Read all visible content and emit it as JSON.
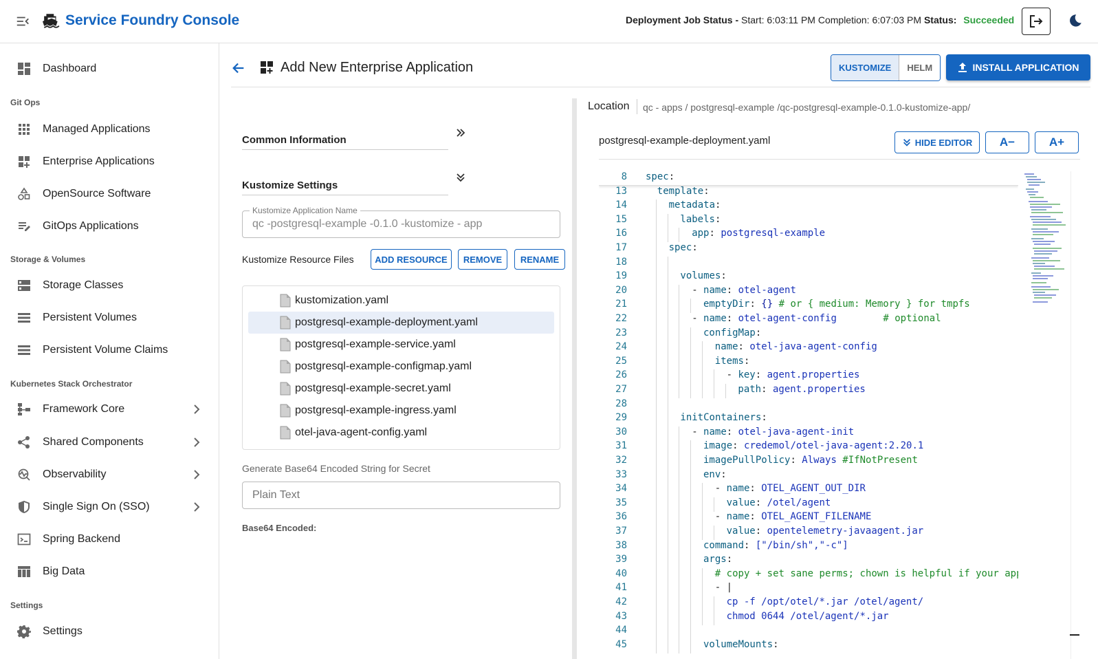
{
  "app": {
    "title": "Service Foundry Console"
  },
  "job_status": {
    "label": "Deployment Job Status -",
    "start_label": "Start:",
    "start": "6:03:11 PM",
    "completion_label": "Completion:",
    "completion": "6:07:03 PM",
    "status_label": "Status:",
    "status": "Succeeded",
    "status_color": "#2e9e3f"
  },
  "sidebar": {
    "items": [
      {
        "label": "Dashboard",
        "icon": "dashboard-icon"
      },
      {
        "section": "Git Ops"
      },
      {
        "label": "Managed Applications",
        "icon": "apps-grid-icon"
      },
      {
        "label": "Enterprise Applications",
        "icon": "widgets-add-icon"
      },
      {
        "label": "OpenSource Software",
        "icon": "shapes-icon"
      },
      {
        "label": "GitOps Applications",
        "icon": "edit-note-icon"
      },
      {
        "section": "Storage & Volumes"
      },
      {
        "label": "Storage Classes",
        "icon": "storage-icon"
      },
      {
        "label": "Persistent Volumes",
        "icon": "list-stack-icon"
      },
      {
        "label": "Persistent Volume Claims",
        "icon": "list-stack-icon"
      },
      {
        "section": "Kubernetes Stack Orchestrator"
      },
      {
        "label": "Framework Core",
        "icon": "schema-icon"
      },
      {
        "label": "Shared Components",
        "icon": "share-icon"
      },
      {
        "label": "Observability",
        "icon": "monitoring-icon"
      },
      {
        "label": "Single Sign On (SSO)",
        "icon": "shield-icon"
      },
      {
        "label": "Spring Backend",
        "icon": "terminal-icon"
      },
      {
        "label": "Big Data",
        "icon": "table-icon"
      },
      {
        "section": "Settings"
      },
      {
        "label": "Settings",
        "icon": "gear-icon"
      }
    ]
  },
  "page": {
    "title": "Add New Enterprise Application",
    "toggle": {
      "kustomize": "KUSTOMIZE",
      "helm": "HELM"
    },
    "install_label": "INSTALL APPLICATION"
  },
  "form": {
    "common_info": "Common Information",
    "kustomize_settings": "Kustomize Settings",
    "app_name_label": "Kustomize Application Name",
    "app_name_value": "qc -postgresql-example -0.1.0 -kustomize - app",
    "resource_files_label": "Kustomize Resource Files",
    "add_resource": "ADD RESOURCE",
    "remove": "REMOVE",
    "rename": "RENAME",
    "files": [
      "kustomization.yaml",
      "postgresql-example-deployment.yaml",
      "postgresql-example-service.yaml",
      "postgresql-example-configmap.yaml",
      "postgresql-example-secret.yaml",
      "postgresql-example-ingress.yaml",
      "otel-java-agent-config.yaml"
    ],
    "selected_file_index": 1,
    "base64_label": "Generate Base64 Encoded String for Secret",
    "base64_placeholder": "Plain Text",
    "base64_encoded_label": "Base64 Encoded:"
  },
  "editor": {
    "location_label": "Location",
    "location_path": "qc - apps / postgresql-example /qc-postgresql-example-0.1.0-kustomize-app/",
    "file_name": "postgresql-example-deployment.yaml",
    "hide_editor": "HIDE EDITOR",
    "font_smaller": "A−",
    "font_larger": "A+",
    "sticky_line": {
      "n": "8",
      "indent": 0,
      "parts": [
        [
          "k",
          "spec"
        ],
        [
          "p",
          ":"
        ]
      ]
    },
    "lines": [
      {
        "n": "13",
        "indent": 1,
        "parts": [
          [
            "k",
            "template"
          ],
          [
            "p",
            ":"
          ]
        ]
      },
      {
        "n": "14",
        "indent": 2,
        "parts": [
          [
            "k",
            "metadata"
          ],
          [
            "p",
            ":"
          ]
        ]
      },
      {
        "n": "15",
        "indent": 3,
        "parts": [
          [
            "k",
            "labels"
          ],
          [
            "p",
            ":"
          ]
        ]
      },
      {
        "n": "16",
        "indent": 4,
        "parts": [
          [
            "k",
            "app"
          ],
          [
            "p",
            ": "
          ],
          [
            "v",
            "postgresql-example"
          ]
        ]
      },
      {
        "n": "17",
        "indent": 2,
        "parts": [
          [
            "k",
            "spec"
          ],
          [
            "p",
            ":"
          ]
        ]
      },
      {
        "n": "18",
        "indent": 3,
        "parts": []
      },
      {
        "n": "19",
        "indent": 3,
        "parts": [
          [
            "k",
            "volumes"
          ],
          [
            "p",
            ":"
          ]
        ]
      },
      {
        "n": "20",
        "indent": 4,
        "parts": [
          [
            "p",
            "- "
          ],
          [
            "k",
            "name"
          ],
          [
            "p",
            ": "
          ],
          [
            "v",
            "otel-agent"
          ]
        ]
      },
      {
        "n": "21",
        "indent": 5,
        "parts": [
          [
            "k",
            "emptyDir"
          ],
          [
            "p",
            ": "
          ],
          [
            "d",
            "{}"
          ],
          [
            "c",
            " # or { medium: Memory } for tmpfs"
          ]
        ]
      },
      {
        "n": "22",
        "indent": 4,
        "parts": [
          [
            "p",
            "- "
          ],
          [
            "k",
            "name"
          ],
          [
            "p",
            ": "
          ],
          [
            "v",
            "otel-agent-config"
          ],
          [
            "c",
            "        # optional"
          ]
        ]
      },
      {
        "n": "23",
        "indent": 5,
        "parts": [
          [
            "k",
            "configMap"
          ],
          [
            "p",
            ":"
          ]
        ]
      },
      {
        "n": "24",
        "indent": 6,
        "parts": [
          [
            "k",
            "name"
          ],
          [
            "p",
            ": "
          ],
          [
            "v",
            "otel-java-agent-config"
          ]
        ]
      },
      {
        "n": "25",
        "indent": 6,
        "parts": [
          [
            "k",
            "items"
          ],
          [
            "p",
            ":"
          ]
        ]
      },
      {
        "n": "26",
        "indent": 7,
        "parts": [
          [
            "p",
            "- "
          ],
          [
            "k",
            "key"
          ],
          [
            "p",
            ": "
          ],
          [
            "v",
            "agent.properties"
          ]
        ]
      },
      {
        "n": "27",
        "indent": 8,
        "parts": [
          [
            "k",
            "path"
          ],
          [
            "p",
            ": "
          ],
          [
            "v",
            "agent.properties"
          ]
        ]
      },
      {
        "n": "28",
        "indent": 3,
        "parts": []
      },
      {
        "n": "29",
        "indent": 3,
        "parts": [
          [
            "k",
            "initContainers"
          ],
          [
            "p",
            ":"
          ]
        ]
      },
      {
        "n": "30",
        "indent": 4,
        "parts": [
          [
            "p",
            "- "
          ],
          [
            "k",
            "name"
          ],
          [
            "p",
            ": "
          ],
          [
            "v",
            "otel-java-agent-init"
          ]
        ]
      },
      {
        "n": "31",
        "indent": 5,
        "parts": [
          [
            "k",
            "image"
          ],
          [
            "p",
            ": "
          ],
          [
            "v",
            "credemol/otel-java-agent:2.20.1"
          ]
        ]
      },
      {
        "n": "32",
        "indent": 5,
        "parts": [
          [
            "k",
            "imagePullPolicy"
          ],
          [
            "p",
            ": "
          ],
          [
            "v",
            "Always"
          ],
          [
            "c",
            " #IfNotPresent"
          ]
        ]
      },
      {
        "n": "33",
        "indent": 5,
        "parts": [
          [
            "k",
            "env"
          ],
          [
            "p",
            ":"
          ]
        ]
      },
      {
        "n": "34",
        "indent": 6,
        "parts": [
          [
            "p",
            "- "
          ],
          [
            "k",
            "name"
          ],
          [
            "p",
            ": "
          ],
          [
            "v",
            "OTEL_AGENT_OUT_DIR"
          ]
        ]
      },
      {
        "n": "35",
        "indent": 7,
        "parts": [
          [
            "k",
            "value"
          ],
          [
            "p",
            ": "
          ],
          [
            "v",
            "/otel/agent"
          ]
        ]
      },
      {
        "n": "36",
        "indent": 6,
        "parts": [
          [
            "p",
            "- "
          ],
          [
            "k",
            "name"
          ],
          [
            "p",
            ": "
          ],
          [
            "v",
            "OTEL_AGENT_FILENAME"
          ]
        ]
      },
      {
        "n": "37",
        "indent": 7,
        "parts": [
          [
            "k",
            "value"
          ],
          [
            "p",
            ": "
          ],
          [
            "v",
            "opentelemetry-javaagent.jar"
          ]
        ]
      },
      {
        "n": "38",
        "indent": 5,
        "parts": [
          [
            "k",
            "command"
          ],
          [
            "p",
            ": "
          ],
          [
            "v",
            "[\"/bin/sh\",\"-c\"]"
          ]
        ]
      },
      {
        "n": "39",
        "indent": 5,
        "parts": [
          [
            "k",
            "args"
          ],
          [
            "p",
            ":"
          ]
        ]
      },
      {
        "n": "40",
        "indent": 6,
        "parts": [
          [
            "c",
            "# copy + set sane perms; chown is helpful if your app"
          ]
        ]
      },
      {
        "n": "41",
        "indent": 6,
        "parts": [
          [
            "p",
            "- |"
          ]
        ]
      },
      {
        "n": "42",
        "indent": 7,
        "parts": [
          [
            "v",
            "cp -f /opt/otel/*.jar /otel/agent/"
          ]
        ]
      },
      {
        "n": "43",
        "indent": 7,
        "parts": [
          [
            "v",
            "chmod 0644 /otel/agent/*.jar"
          ]
        ]
      },
      {
        "n": "44",
        "indent": 5,
        "parts": []
      },
      {
        "n": "45",
        "indent": 5,
        "parts": [
          [
            "k",
            "volumeMounts"
          ],
          [
            "p",
            ":"
          ]
        ]
      }
    ]
  },
  "colors": {
    "accent": "#1565c0",
    "success": "#2e9e3f"
  }
}
